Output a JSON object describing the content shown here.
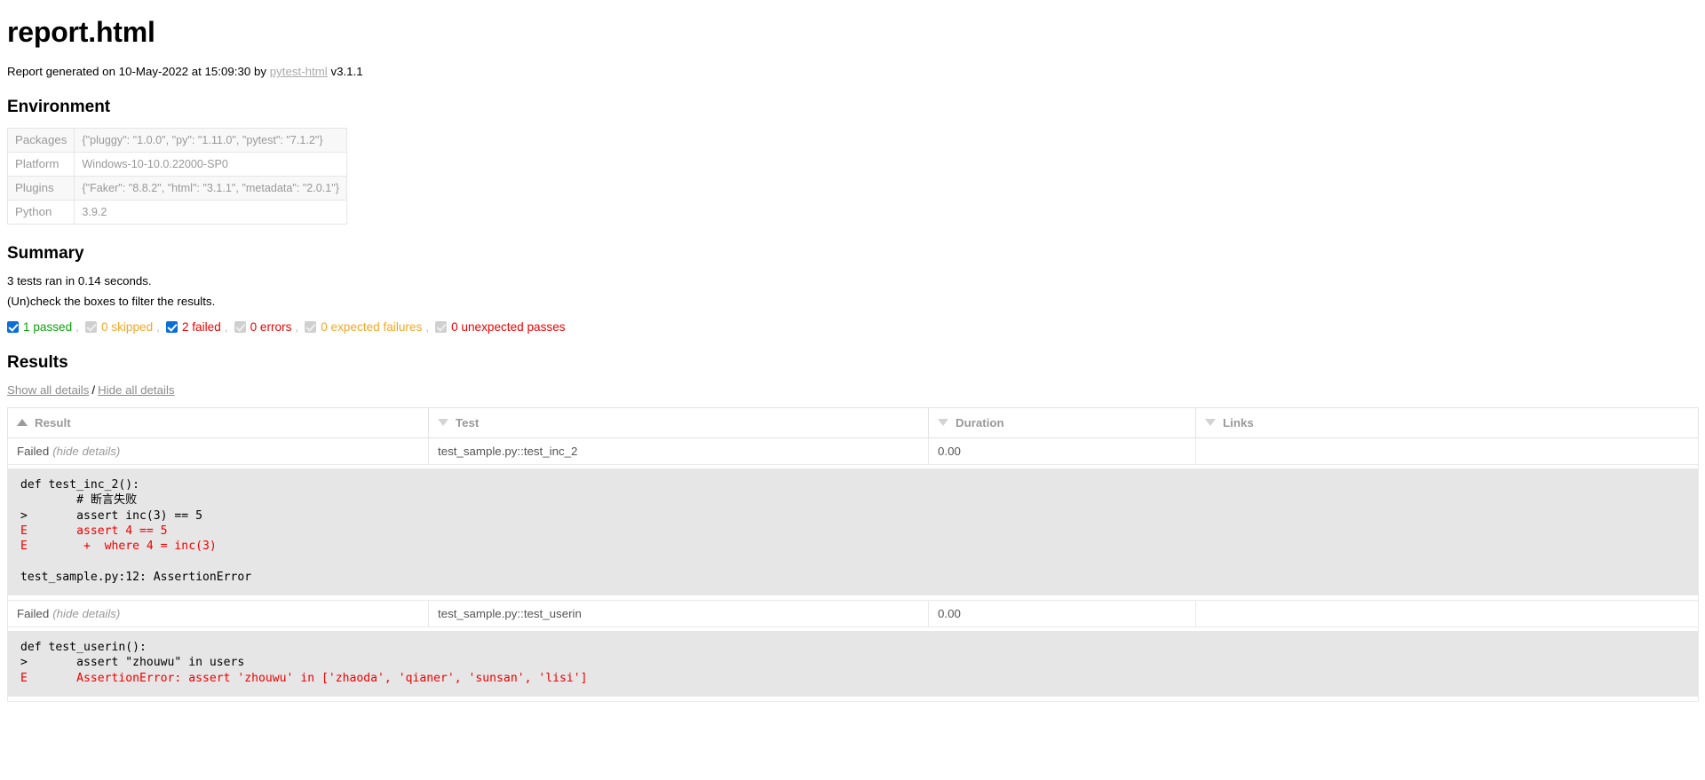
{
  "page": {
    "title": "report.html",
    "generated_prefix": "Report generated on ",
    "generated_date": "10-May-2022",
    "generated_at_word": " at ",
    "generated_time": "15:09:30",
    "generated_by_word": " by ",
    "generator_link": "pytest-html",
    "generator_version": " v3.1.1"
  },
  "environment": {
    "heading": "Environment",
    "rows": [
      {
        "key": "Packages",
        "value": "{\"pluggy\": \"1.0.0\", \"py\": \"1.11.0\", \"pytest\": \"7.1.2\"}"
      },
      {
        "key": "Platform",
        "value": "Windows-10-10.0.22000-SP0"
      },
      {
        "key": "Plugins",
        "value": "{\"Faker\": \"8.8.2\", \"html\": \"3.1.1\", \"metadata\": \"2.0.1\"}"
      },
      {
        "key": "Python",
        "value": "3.9.2"
      }
    ]
  },
  "summary": {
    "heading": "Summary",
    "run_line": "3 tests ran in 0.14 seconds.",
    "filter_hint": "(Un)check the boxes to filter the results.",
    "filters": [
      {
        "label": "1 passed",
        "checked": true,
        "color_class": "c-passed",
        "name": "passed"
      },
      {
        "label": "0 skipped",
        "checked": false,
        "color_class": "c-skipped",
        "name": "skipped"
      },
      {
        "label": "2 failed",
        "checked": true,
        "color_class": "c-failed",
        "name": "failed"
      },
      {
        "label": "0 errors",
        "checked": false,
        "color_class": "c-error",
        "name": "errors"
      },
      {
        "label": "0 expected failures",
        "checked": false,
        "color_class": "c-xfailed",
        "name": "expected-failures"
      },
      {
        "label": "0 unexpected passes",
        "checked": false,
        "color_class": "c-xpassed",
        "name": "unexpected-passes"
      }
    ]
  },
  "results": {
    "heading": "Results",
    "show_all": "Show all details",
    "separator": "/",
    "hide_all": "Hide all details",
    "columns": [
      {
        "label": "Result",
        "sort": "asc"
      },
      {
        "label": "Test",
        "sort": "desc"
      },
      {
        "label": "Duration",
        "sort": "desc"
      },
      {
        "label": "Links",
        "sort": "desc"
      }
    ],
    "rows": [
      {
        "result": "Failed",
        "toggle": "(hide details)",
        "test": "test_sample.py::test_inc_2",
        "duration": "0.00",
        "links": "",
        "log_lines": [
          {
            "text": "def test_inc_2():",
            "style": "plain"
          },
          {
            "text": "        # 断言失败",
            "style": "plain"
          },
          {
            "text": ">       assert inc(3) == 5",
            "style": "plain"
          },
          {
            "text": "E       assert 4 == 5",
            "style": "err"
          },
          {
            "text": "E        +  where 4 = inc(3)",
            "style": "err"
          },
          {
            "text": "",
            "style": "plain"
          },
          {
            "text": "test_sample.py:12: AssertionError",
            "style": "plain"
          }
        ]
      },
      {
        "result": "Failed",
        "toggle": "(hide details)",
        "test": "test_sample.py::test_userin",
        "duration": "0.00",
        "links": "",
        "log_lines": [
          {
            "text": "def test_userin():",
            "style": "plain"
          },
          {
            "text": ">       assert \"zhouwu\" in users",
            "style": "plain"
          },
          {
            "text": "E       AssertionError: assert 'zhouwu' in ['zhaoda', 'qianer', 'sunsan', 'lisi']",
            "style": "err"
          }
        ]
      }
    ]
  }
}
